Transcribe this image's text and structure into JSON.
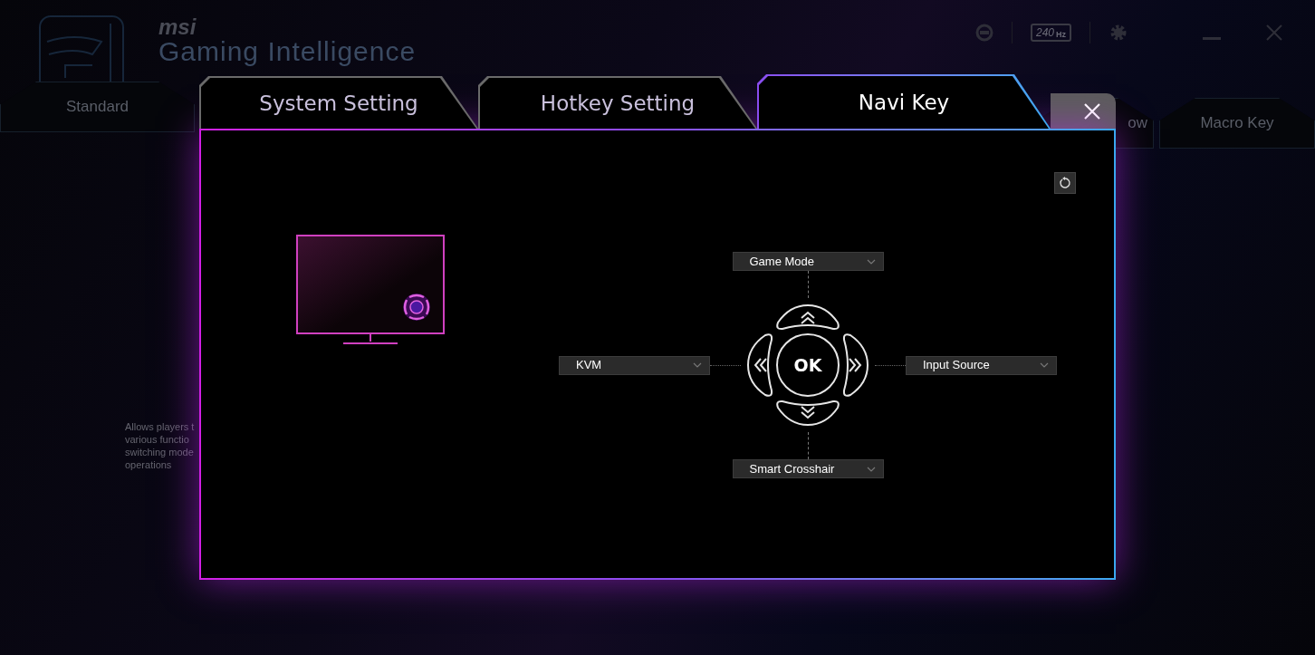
{
  "app": {
    "brand": "msi",
    "title": "Gaming Intelligence",
    "refresh_rate": "240",
    "refresh_unit": "Hz",
    "tabs": [
      {
        "label": "Standard",
        "selected": false
      },
      {
        "label": "ow",
        "selected": false
      },
      {
        "label": "Macro Key",
        "selected": false
      }
    ],
    "description_lines": [
      "Allows players t",
      "various functio",
      "switching mode",
      "operations"
    ]
  },
  "dialog": {
    "tabs": [
      {
        "label": "System Setting",
        "selected": false
      },
      {
        "label": "Hotkey Setting",
        "selected": false
      },
      {
        "label": "Navi Key",
        "selected": true
      }
    ],
    "navi_key": {
      "up": "Game Mode",
      "left": "KVM",
      "right": "Input Source",
      "down": "Smart Crosshair",
      "center": "OK"
    }
  }
}
